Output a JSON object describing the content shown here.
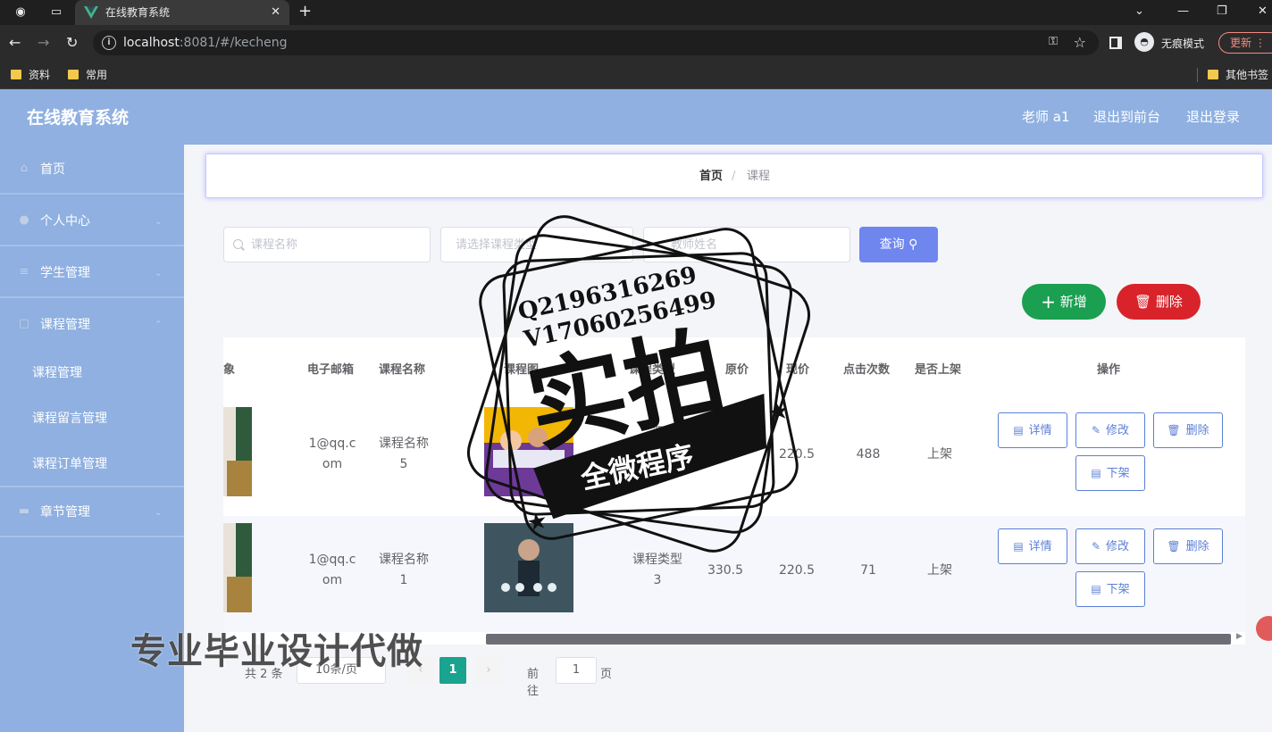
{
  "browser": {
    "tab_title": "在线教育系统",
    "url_host": "localhost",
    "url_rest": ":8081/#/kecheng",
    "incognito_label": "无痕模式",
    "update_label": "更新",
    "bookmarks": [
      "资料",
      "常用"
    ],
    "other_bookmarks": "其他书签"
  },
  "header": {
    "title": "在线教育系统",
    "user": "老师 a1",
    "front_link": "退出到前台",
    "logout_link": "退出登录"
  },
  "sidebar": {
    "items": [
      {
        "label": "首页",
        "icon": "home-icon"
      },
      {
        "label": "个人中心",
        "icon": "user-icon"
      },
      {
        "label": "学生管理",
        "icon": "list-icon"
      },
      {
        "label": "课程管理",
        "icon": "book-icon"
      },
      {
        "label": "章节管理",
        "icon": "chapter-icon"
      }
    ],
    "subitems": [
      "课程管理",
      "课程留言管理",
      "课程订单管理"
    ]
  },
  "breadcrumb": {
    "home": "首页",
    "separator": "/",
    "current": "课程"
  },
  "search": {
    "name_placeholder": "课程名称",
    "type_placeholder": "请选择课程类型",
    "teacher_placeholder": "教师姓名",
    "query_label": "查询"
  },
  "actions": {
    "add_label": "新增",
    "delete_label": "删除"
  },
  "table": {
    "headers": [
      "象",
      "电子邮箱",
      "课程名称",
      "课程图",
      "课程类型",
      "原价",
      "现价",
      "点击次数",
      "是否上架",
      "操作"
    ],
    "rows": [
      {
        "email_1": "1@qq.c",
        "email_2": "om",
        "name_1": "课程名称",
        "name_2": "5",
        "type_1": "课",
        "type_2": "",
        "original": "",
        "price": "220.5",
        "clicks": "488",
        "status": "上架"
      },
      {
        "email_1": "1@qq.c",
        "email_2": "om",
        "name_1": "课程名称",
        "name_2": "1",
        "type_1": "课程类型",
        "type_2": "3",
        "original": "330.5",
        "price": "220.5",
        "clicks": "71",
        "status": "上架"
      }
    ],
    "op_labels": {
      "detail": "详情",
      "edit": "修改",
      "delete": "删除",
      "offshelf": "下架"
    }
  },
  "pagination": {
    "total": "共 2 条",
    "page_size": "10条/页",
    "current": "1",
    "goto_label": "前往",
    "goto_value": "1",
    "page_label": "页"
  },
  "watermark": {
    "contact_1": "Q2196316269",
    "contact_2": "V17060256499",
    "big_text": "实拍",
    "ribbon_text": "全微程序",
    "bottom_text": "专业毕业设计代做"
  },
  "colors": {
    "header_bg": "#8fb0e0",
    "query_btn": "#6f86ef",
    "add_btn": "#1aa050",
    "delete_btn": "#d9232a",
    "pager_active": "#1aa38f",
    "op_btn": "#5b7fd6"
  }
}
